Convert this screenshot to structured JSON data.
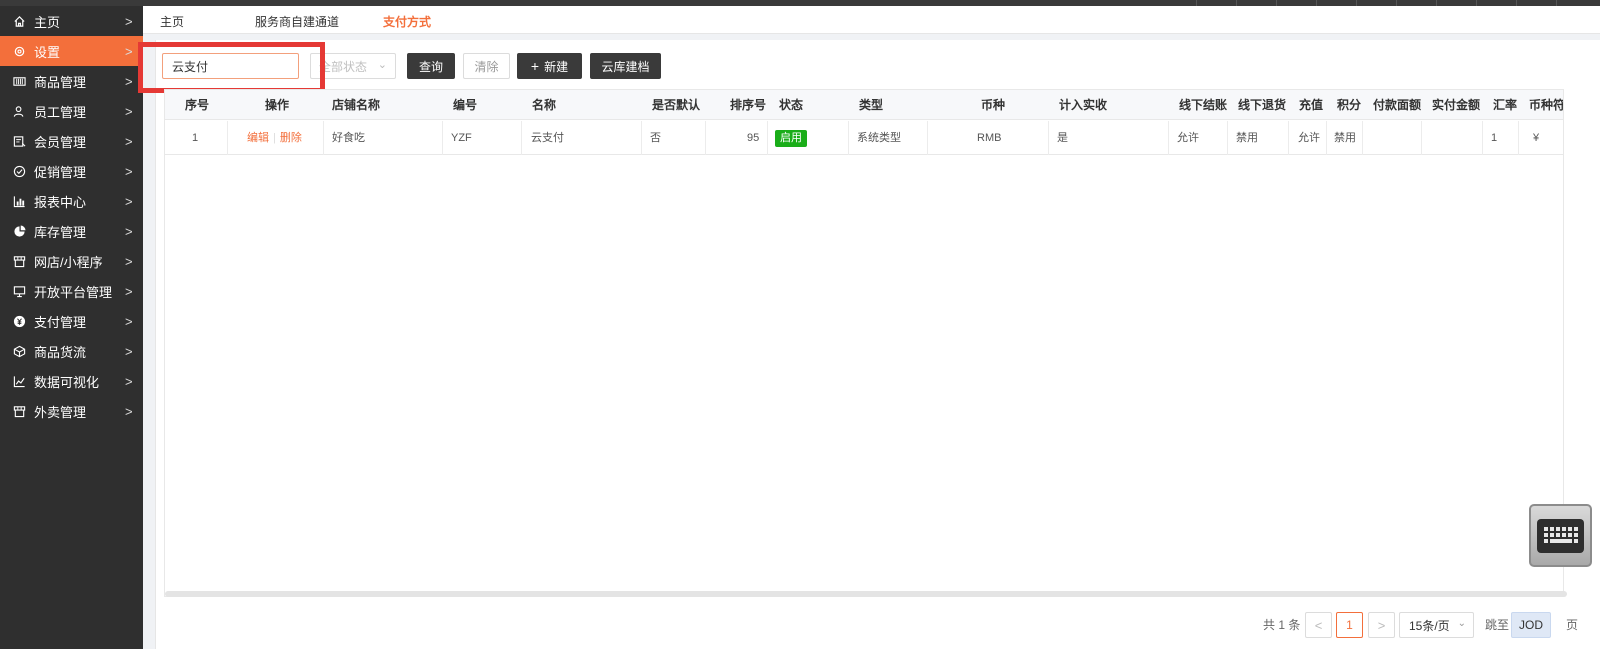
{
  "sidebar": {
    "items": [
      {
        "label": "主页",
        "icon": "home-icon",
        "active": false
      },
      {
        "label": "设置",
        "icon": "gear-icon",
        "active": true
      },
      {
        "label": "商品管理",
        "icon": "barcode-icon",
        "active": false
      },
      {
        "label": "员工管理",
        "icon": "users-icon",
        "active": false
      },
      {
        "label": "会员管理",
        "icon": "member-card-icon",
        "active": false
      },
      {
        "label": "促销管理",
        "icon": "check-circle-icon",
        "active": false
      },
      {
        "label": "报表中心",
        "icon": "bar-chart-icon",
        "active": false
      },
      {
        "label": "库存管理",
        "icon": "pie-chart-icon",
        "active": false
      },
      {
        "label": "网店/小程序",
        "icon": "store-icon",
        "active": false
      },
      {
        "label": "开放平台管理",
        "icon": "monitor-icon",
        "active": false
      },
      {
        "label": "支付管理",
        "icon": "payment-icon",
        "active": false
      },
      {
        "label": "商品货流",
        "icon": "cube-icon",
        "active": false
      },
      {
        "label": "数据可视化",
        "icon": "line-chart-icon",
        "active": false
      },
      {
        "label": "外卖管理",
        "icon": "shop-icon",
        "active": false
      }
    ],
    "arrow": ">"
  },
  "tabs": [
    {
      "label": "主页",
      "active": false
    },
    {
      "label": "服务商自建通道",
      "active": false
    },
    {
      "label": "支付方式",
      "active": true
    }
  ],
  "filters": {
    "search_value": "云支付",
    "status_placeholder": "全部状态",
    "query_label": "查询",
    "clear_label": "清除",
    "new_label": "新建",
    "cloud_label": "云库建档"
  },
  "table": {
    "columns": [
      "序号",
      "操作",
      "店铺名称",
      "编号",
      "名称",
      "是否默认",
      "排序号",
      "状态",
      "类型",
      "币种",
      "计入实收",
      "线下结账",
      "线下退货",
      "充值",
      "积分",
      "付款面额",
      "实付金额",
      "汇率",
      "币种符号"
    ],
    "rows": [
      {
        "index": "1",
        "edit": "编辑",
        "delete": "删除",
        "store": "好食吃",
        "code": "YZF",
        "name": "云支付",
        "is_default": "否",
        "sort": "95",
        "status": "启用",
        "type": "系统类型",
        "currency": "RMB",
        "count_income": "是",
        "offline_checkout": "允许",
        "offline_return": "禁用",
        "recharge": "允许",
        "points": "禁用",
        "face_value": "",
        "paid_amount": "",
        "rate": "1",
        "currency_symbol": "¥"
      }
    ]
  },
  "pagination": {
    "total_text": "共 1 条",
    "prev": "<",
    "current": "1",
    "next": ">",
    "page_size": "15条/页",
    "jump_label": "跳至",
    "jump_value": "JOD",
    "page_suffix": "页"
  },
  "colors": {
    "accent": "#f36f3b",
    "sidebar_bg": "#2f2f2f",
    "status_green": "#1aad19",
    "highlight_red": "#e53935"
  }
}
